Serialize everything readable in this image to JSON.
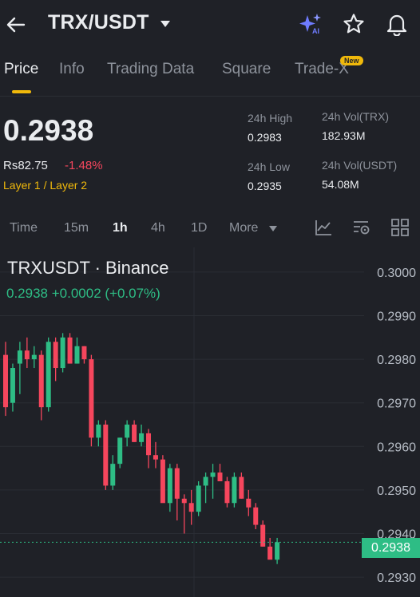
{
  "header": {
    "pair": "TRX/USDT",
    "icons": [
      "back-arrow-icon",
      "caret-down-icon",
      "ai-sparkle-icon",
      "star-icon",
      "bell-icon"
    ]
  },
  "tabs": [
    {
      "label": "Price",
      "active": true
    },
    {
      "label": "Info"
    },
    {
      "label": "Trading Data"
    },
    {
      "label": "Square"
    },
    {
      "label": "Trade-X",
      "badge": "New"
    }
  ],
  "summary": {
    "price": "0.2938",
    "fiat": "Rs82.75",
    "change": "-1.48%",
    "tag": "Layer 1 / Layer 2",
    "high_label": "24h High",
    "high_value": "0.2983",
    "low_label": "24h Low",
    "low_value": "0.2935",
    "vol_trx_label": "24h Vol(TRX)",
    "vol_trx_value": "182.93M",
    "vol_usdt_label": "24h Vol(USDT)",
    "vol_usdt_value": "54.08M"
  },
  "intervals": {
    "items": [
      "Time",
      "15m",
      "1h",
      "4h",
      "1D",
      "More"
    ],
    "active": "1h",
    "tool_icons": [
      "indicator-icon",
      "settings-icon",
      "grid-layout-icon"
    ]
  },
  "chart_data": {
    "type": "candlestick",
    "title": "TRXUSDT · Binance",
    "quote": "0.2938  +0.0002 (+0.07%)",
    "last_price": "0.2938",
    "y_ticks": [
      "0.3000",
      "0.2990",
      "0.2980",
      "0.2970",
      "0.2960",
      "0.2950",
      "0.2940",
      "0.2930"
    ],
    "ylim": [
      0.2928,
      0.3002
    ],
    "up_color": "#2ebd85",
    "down_color": "#f6465d",
    "candles": [
      {
        "o": 0.2981,
        "h": 0.2984,
        "l": 0.2967,
        "c": 0.2969
      },
      {
        "o": 0.297,
        "h": 0.2979,
        "l": 0.2968,
        "c": 0.2978
      },
      {
        "o": 0.2979,
        "h": 0.2984,
        "l": 0.2972,
        "c": 0.2982
      },
      {
        "o": 0.2982,
        "h": 0.2985,
        "l": 0.2978,
        "c": 0.298
      },
      {
        "o": 0.298,
        "h": 0.2983,
        "l": 0.2978,
        "c": 0.2981
      },
      {
        "o": 0.2981,
        "h": 0.2982,
        "l": 0.2966,
        "c": 0.2969
      },
      {
        "o": 0.2969,
        "h": 0.2985,
        "l": 0.2968,
        "c": 0.2984
      },
      {
        "o": 0.2984,
        "h": 0.2985,
        "l": 0.2975,
        "c": 0.2978
      },
      {
        "o": 0.2978,
        "h": 0.2986,
        "l": 0.2977,
        "c": 0.2985
      },
      {
        "o": 0.2985,
        "h": 0.2986,
        "l": 0.2979,
        "c": 0.2979
      },
      {
        "o": 0.2979,
        "h": 0.2985,
        "l": 0.2979,
        "c": 0.2983
      },
      {
        "o": 0.2983,
        "h": 0.2983,
        "l": 0.2979,
        "c": 0.298
      },
      {
        "o": 0.298,
        "h": 0.2981,
        "l": 0.296,
        "c": 0.2962
      },
      {
        "o": 0.2962,
        "h": 0.2966,
        "l": 0.296,
        "c": 0.2965
      },
      {
        "o": 0.2965,
        "h": 0.2966,
        "l": 0.295,
        "c": 0.2951
      },
      {
        "o": 0.2951,
        "h": 0.2958,
        "l": 0.295,
        "c": 0.2956
      },
      {
        "o": 0.2956,
        "h": 0.2962,
        "l": 0.2955,
        "c": 0.2962
      },
      {
        "o": 0.2962,
        "h": 0.2966,
        "l": 0.296,
        "c": 0.2965
      },
      {
        "o": 0.2965,
        "h": 0.2966,
        "l": 0.2961,
        "c": 0.2961
      },
      {
        "o": 0.2961,
        "h": 0.2965,
        "l": 0.296,
        "c": 0.2963
      },
      {
        "o": 0.2963,
        "h": 0.2964,
        "l": 0.2955,
        "c": 0.2958
      },
      {
        "o": 0.2958,
        "h": 0.2961,
        "l": 0.2955,
        "c": 0.2957
      },
      {
        "o": 0.2957,
        "h": 0.2958,
        "l": 0.2949,
        "c": 0.2947
      },
      {
        "o": 0.2947,
        "h": 0.2956,
        "l": 0.2945,
        "c": 0.2955
      },
      {
        "o": 0.2955,
        "h": 0.2956,
        "l": 0.2943,
        "c": 0.2948
      },
      {
        "o": 0.2948,
        "h": 0.2949,
        "l": 0.294,
        "c": 0.2947
      },
      {
        "o": 0.2947,
        "h": 0.295,
        "l": 0.2942,
        "c": 0.2945
      },
      {
        "o": 0.2945,
        "h": 0.2952,
        "l": 0.2944,
        "c": 0.2951
      },
      {
        "o": 0.2951,
        "h": 0.2954,
        "l": 0.2947,
        "c": 0.2953
      },
      {
        "o": 0.2953,
        "h": 0.2956,
        "l": 0.2948,
        "c": 0.2954
      },
      {
        "o": 0.2954,
        "h": 0.2956,
        "l": 0.2952,
        "c": 0.2952
      },
      {
        "o": 0.2952,
        "h": 0.2953,
        "l": 0.2946,
        "c": 0.2947
      },
      {
        "o": 0.2947,
        "h": 0.2954,
        "l": 0.2946,
        "c": 0.2953
      },
      {
        "o": 0.2953,
        "h": 0.2954,
        "l": 0.2948,
        "c": 0.2948
      },
      {
        "o": 0.2948,
        "h": 0.295,
        "l": 0.2944,
        "c": 0.2946
      },
      {
        "o": 0.2946,
        "h": 0.2947,
        "l": 0.2941,
        "c": 0.2942
      },
      {
        "o": 0.2942,
        "h": 0.2943,
        "l": 0.2937,
        "c": 0.2937
      },
      {
        "o": 0.2937,
        "h": 0.2939,
        "l": 0.2935,
        "c": 0.2934
      },
      {
        "o": 0.2934,
        "h": 0.2939,
        "l": 0.2933,
        "c": 0.2938
      }
    ]
  }
}
